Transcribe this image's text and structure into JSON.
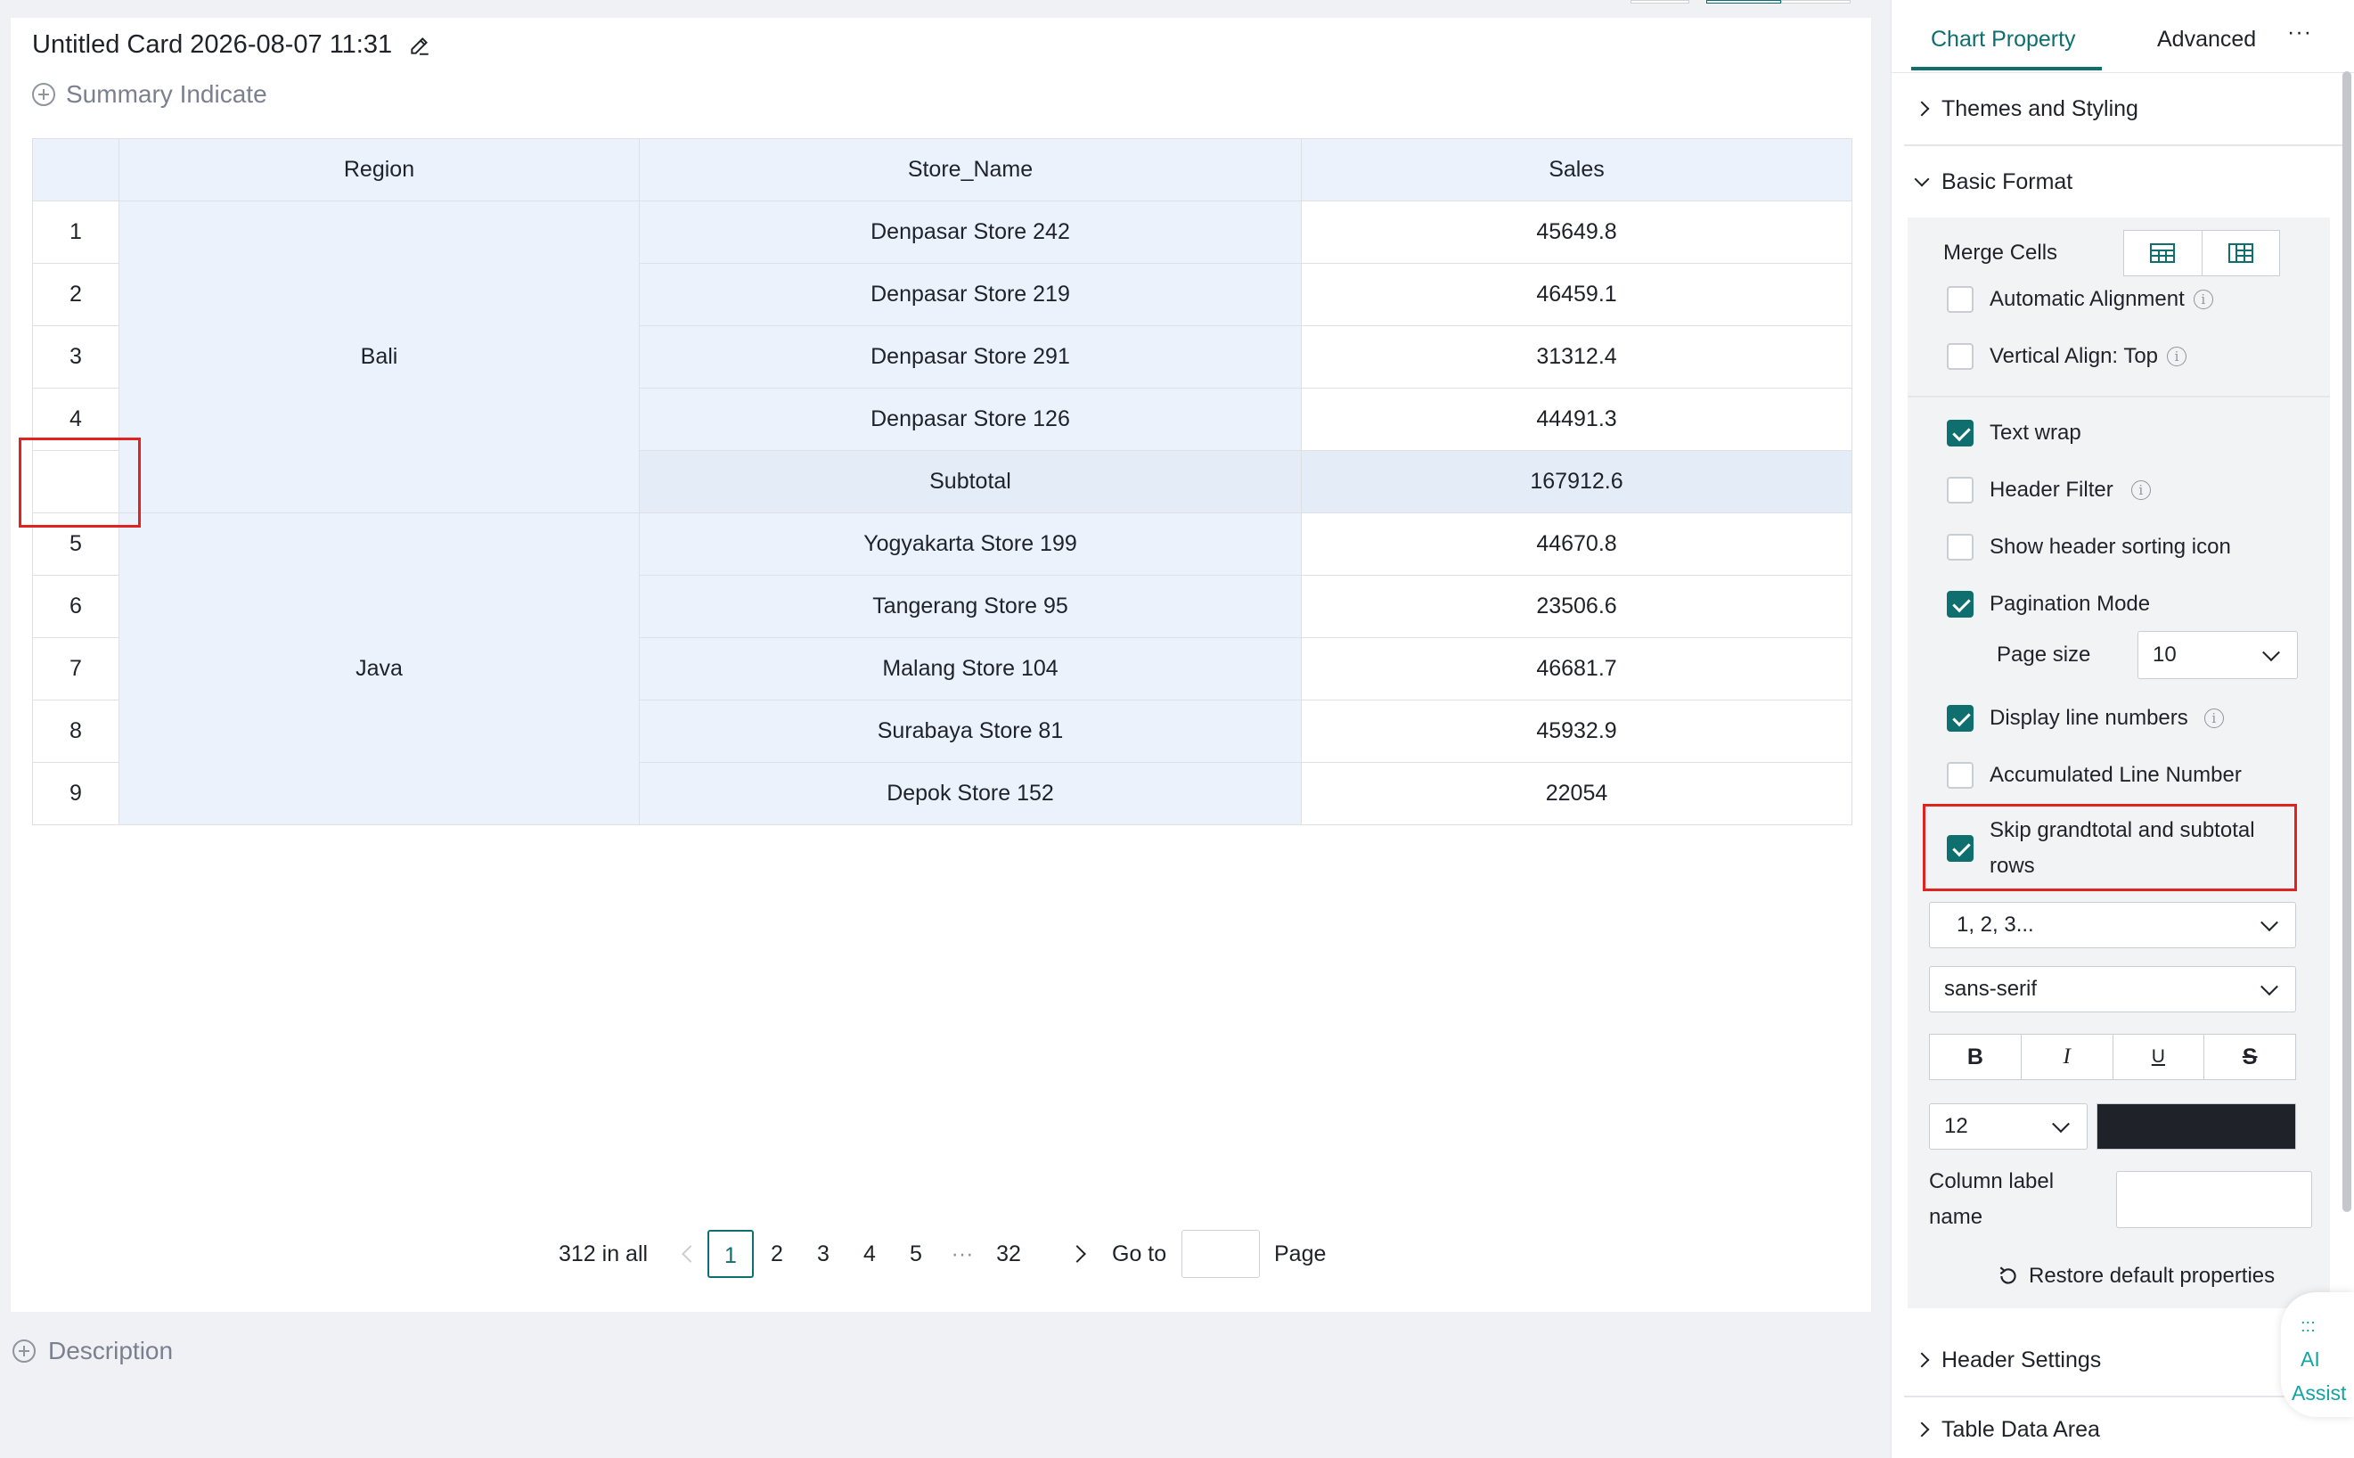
{
  "card": {
    "title": "Untitled Card 2026-08-07 11:31",
    "summary_label": "Summary Indicate",
    "description_label": "Description"
  },
  "table": {
    "columns": [
      "Region",
      "Store_Name",
      "Sales"
    ],
    "groups": [
      {
        "region": "Bali",
        "rows": [
          {
            "num": "1",
            "store": "Denpasar Store 242",
            "sales": "45649.8"
          },
          {
            "num": "2",
            "store": "Denpasar Store 219",
            "sales": "46459.1"
          },
          {
            "num": "3",
            "store": "Denpasar Store 291",
            "sales": "31312.4"
          },
          {
            "num": "4",
            "store": "Denpasar Store 126",
            "sales": "44491.3"
          },
          {
            "num": "",
            "store": "Subtotal",
            "sales": "167912.6"
          }
        ]
      },
      {
        "region": "Java",
        "rows": [
          {
            "num": "5",
            "store": "Yogyakarta Store 199",
            "sales": "44670.8"
          },
          {
            "num": "6",
            "store": "Tangerang Store 95",
            "sales": "23506.6"
          },
          {
            "num": "7",
            "store": "Malang Store 104",
            "sales": "46681.7"
          },
          {
            "num": "8",
            "store": "Surabaya Store 81",
            "sales": "45932.9"
          },
          {
            "num": "9",
            "store": "Depok Store 152",
            "sales": "22054"
          }
        ]
      }
    ]
  },
  "pagination": {
    "total": "312 in all",
    "pages": [
      "1",
      "2",
      "3",
      "4",
      "5"
    ],
    "ellipsis": "···",
    "last": "32",
    "current": "1",
    "goto_label": "Go to",
    "page_label": "Page"
  },
  "panel": {
    "tabs": {
      "chart_property": "Chart Property",
      "advanced": "Advanced",
      "more": "···"
    },
    "themes": "Themes and Styling",
    "basic_format": "Basic Format",
    "merge_cells": "Merge Cells",
    "auto_align": "Automatic Alignment",
    "valign_top": "Vertical Align: Top",
    "text_wrap": "Text wrap",
    "header_filter": "Header Filter",
    "sort_icon": "Show header sorting icon",
    "pagination_mode": "Pagination Mode",
    "page_size_label": "Page size",
    "page_size_value": "10",
    "line_numbers": "Display line numbers",
    "accum_line": "Accumulated Line Number",
    "skip_totals_1": "Skip grandtotal and subtotal",
    "skip_totals_2": "rows",
    "numbering_select": "1, 2, 3...",
    "font_select": "sans-serif",
    "fmt": {
      "bold": "B",
      "italic": "I",
      "underline": "U",
      "strike": "S"
    },
    "font_size": "12",
    "color_value": "#1f2329",
    "col_label_1": "Column label",
    "col_label_2": "name",
    "restore": "Restore default properties",
    "header_settings": "Header Settings",
    "table_data_area": "Table Data Area",
    "checkbox_states": {
      "auto_align": false,
      "valign_top": false,
      "text_wrap": true,
      "header_filter": false,
      "sort_icon": false,
      "pagination_mode": true,
      "line_numbers": true,
      "accum_line": false,
      "skip_totals": true
    }
  },
  "ai": {
    "icon": ":::",
    "line1": "AI",
    "line2": "Assist"
  }
}
